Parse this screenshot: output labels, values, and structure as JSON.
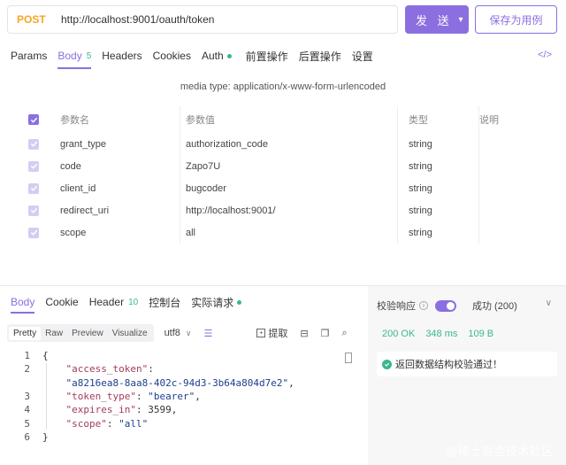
{
  "request": {
    "method": "POST",
    "url": "http://localhost:9001/oauth/token",
    "send_label": "发 送",
    "save_label": "保存为用例"
  },
  "req_tabs": [
    {
      "label": "Params"
    },
    {
      "label": "Body",
      "badge": "5"
    },
    {
      "label": "Headers"
    },
    {
      "label": "Cookies"
    },
    {
      "label": "Auth"
    },
    {
      "label": "前置操作"
    },
    {
      "label": "后置操作"
    },
    {
      "label": "设置"
    }
  ],
  "code_toggle": "</>",
  "media_type": "media type: application/x-www-form-urlencoded",
  "params": {
    "headers": [
      "参数名",
      "参数值",
      "类型",
      "说明"
    ],
    "rows": [
      {
        "name": "grant_type",
        "value": "authorization_code",
        "type": "string"
      },
      {
        "name": "code",
        "value": "Zapo7U",
        "type": "string"
      },
      {
        "name": "client_id",
        "value": "bugcoder",
        "type": "string"
      },
      {
        "name": "redirect_uri",
        "value": "http://localhost:9001/",
        "type": "string"
      },
      {
        "name": "scope",
        "value": "all",
        "type": "string"
      }
    ]
  },
  "res_tabs": [
    {
      "label": "Body"
    },
    {
      "label": "Cookie"
    },
    {
      "label": "Header",
      "badge": "10"
    },
    {
      "label": "控制台"
    },
    {
      "label": "实际请求"
    }
  ],
  "toolbar": {
    "formats": [
      "Pretty",
      "Raw",
      "Preview",
      "Visualize"
    ],
    "encoding": "utf8",
    "extract": "提取"
  },
  "validation": {
    "label": "校验响应",
    "selected": "成功 (200)",
    "status": "200 OK",
    "time": "348 ms",
    "size": "109 B",
    "message": "返回数据结构校验通过！"
  },
  "code_lines": [
    {
      "n": "1",
      "text": "{"
    },
    {
      "n": "2",
      "key": "\"access_token\"",
      "sep": ":"
    },
    {
      "n": "",
      "str": "\"a8216ea8-8aa8-402c-94d3-3b64a804d7e2\"",
      "tail": ","
    },
    {
      "n": "3",
      "key": "\"token_type\"",
      "sep": ": ",
      "str": "\"bearer\"",
      "tail": ","
    },
    {
      "n": "4",
      "key": "\"expires_in\"",
      "sep": ": ",
      "num": "3599",
      "tail": ","
    },
    {
      "n": "5",
      "key": "\"scope\"",
      "sep": ": ",
      "str": "\"all\""
    },
    {
      "n": "6",
      "text": "}"
    }
  ],
  "watermark": "@稀土掘金技术社区"
}
